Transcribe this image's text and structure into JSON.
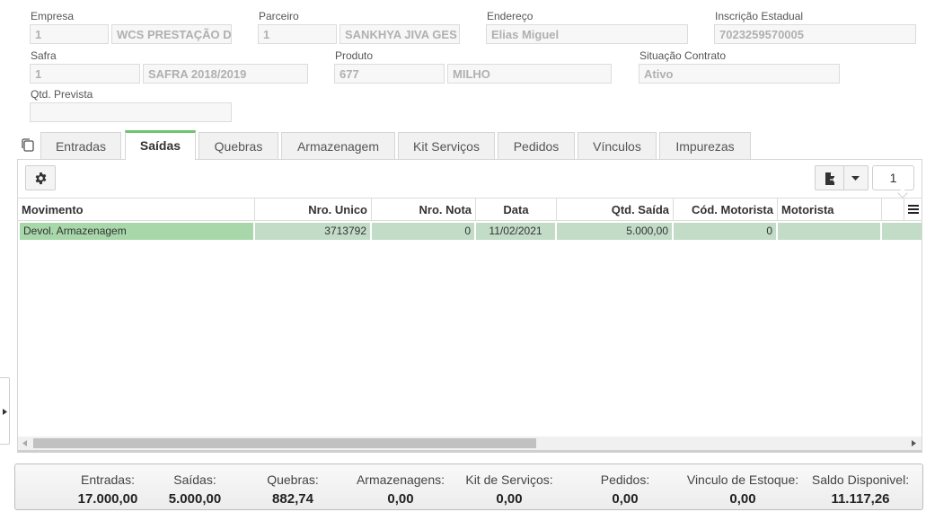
{
  "header": {
    "empresa": {
      "label": "Empresa",
      "code": "1",
      "name": "WCS PRESTAÇÃO D"
    },
    "parceiro": {
      "label": "Parceiro",
      "code": "1",
      "name": "SANKHYA JIVA GES"
    },
    "endereco": {
      "label": "Endereço",
      "value": "Elias Miguel"
    },
    "inscricao": {
      "label": "Inscrição Estadual",
      "value": "7023259570005"
    },
    "safra": {
      "label": "Safra",
      "code": "1",
      "name": "SAFRA 2018/2019"
    },
    "produto": {
      "label": "Produto",
      "code": "677",
      "name": "MILHO"
    },
    "situacao": {
      "label": "Situação Contrato",
      "value": "Ativo"
    },
    "qtd_prevista": {
      "label": "Qtd. Prevista",
      "value": ""
    }
  },
  "tabs": [
    "Entradas",
    "Saídas",
    "Quebras",
    "Armazenagem",
    "Kit Serviços",
    "Pedidos",
    "Vínculos",
    "Impurezas"
  ],
  "active_tab": "Saídas",
  "toolbar": {
    "page_number": "1"
  },
  "grid": {
    "columns": [
      "Movimento",
      "Nro. Unico",
      "Nro. Nota",
      "Data",
      "Qtd. Saída",
      "Cód. Motorista",
      "Motorista"
    ],
    "rows": [
      [
        "Devol. Armazenagem",
        "3713792",
        "0",
        "11/02/2021",
        "5.000,00",
        "0",
        ""
      ]
    ]
  },
  "totals": [
    {
      "label": "Entradas:",
      "value": "17.000,00"
    },
    {
      "label": "Saídas:",
      "value": "5.000,00"
    },
    {
      "label": "Quebras:",
      "value": "882,74"
    },
    {
      "label": "Armazenagens:",
      "value": "0,00"
    },
    {
      "label": "Kit de Serviços:",
      "value": "0,00"
    },
    {
      "label": "Pedidos:",
      "value": "0,00"
    },
    {
      "label": "Vinculo de Estoque:",
      "value": "0,00"
    },
    {
      "label": "Saldo Disponivel:",
      "value": "11.117,26"
    }
  ],
  "colors": {
    "accent": "#6fc46f",
    "row_selected": "#c2dcc8"
  },
  "icons": [
    "copy-icon",
    "gear-icon",
    "export-file-icon",
    "caret-down-icon",
    "column-menu-icon",
    "scroll-left-icon",
    "scroll-right-icon",
    "expand-arrow-icon"
  ]
}
